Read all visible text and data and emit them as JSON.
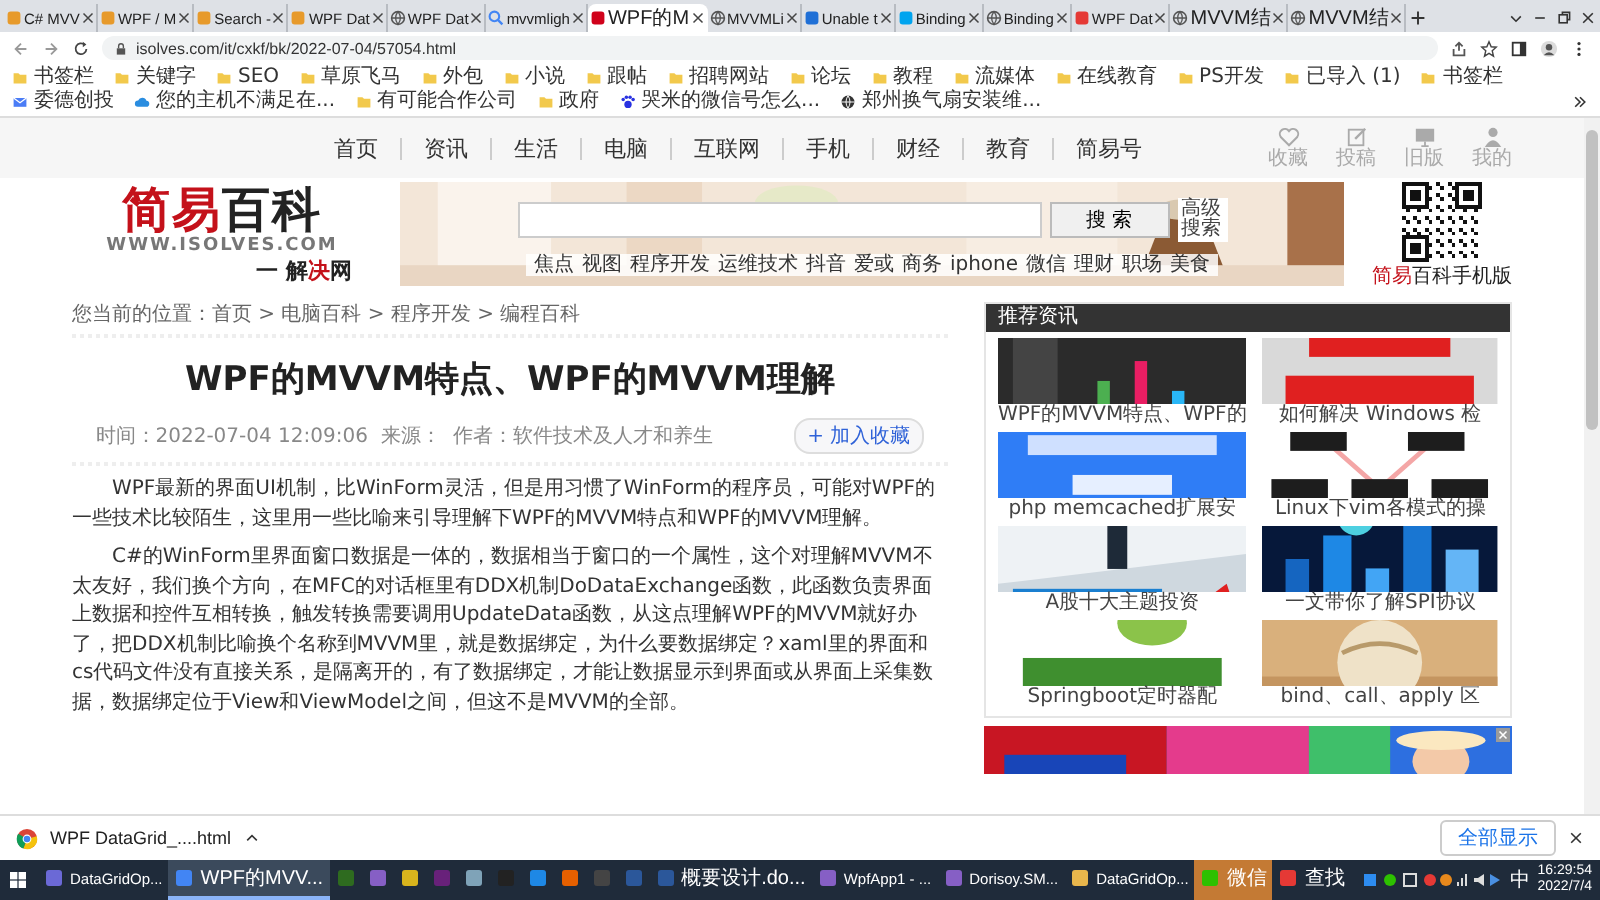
{
  "browser": {
    "tabs": [
      {
        "label": "C# MVV",
        "selected": false,
        "kind": "square",
        "color": "#e79a2b"
      },
      {
        "label": "WPF / M",
        "selected": false,
        "kind": "square",
        "color": "#e79a2b"
      },
      {
        "label": "Search -",
        "selected": false,
        "kind": "square",
        "color": "#e79a2b"
      },
      {
        "label": "WPF Dat",
        "selected": false,
        "kind": "square",
        "color": "#e79a2b"
      },
      {
        "label": "WPF Dat",
        "selected": false,
        "kind": "globe",
        "color": "#555555"
      },
      {
        "label": "mvvmligh",
        "selected": false,
        "kind": "search",
        "color": "#4285f4"
      },
      {
        "label": "WPF的M",
        "selected": true,
        "kind": "square",
        "color": "#d0021b"
      },
      {
        "label": "MVVMLi",
        "selected": false,
        "kind": "globe",
        "color": "#555555"
      },
      {
        "label": "Unable t",
        "selected": false,
        "kind": "square",
        "color": "#1f6fd6"
      },
      {
        "label": "Binding",
        "selected": false,
        "kind": "square",
        "color": "#00a4ef"
      },
      {
        "label": "Binding",
        "selected": false,
        "kind": "globe",
        "color": "#555555"
      },
      {
        "label": "WPF Dat",
        "selected": false,
        "kind": "square",
        "color": "#e53935"
      },
      {
        "label": "MVVM结",
        "selected": false,
        "kind": "globe",
        "color": "#555555"
      },
      {
        "label": "MVVM结",
        "selected": false,
        "kind": "globe",
        "color": "#555555"
      }
    ],
    "address": "isolves.com/it/cxkf/bk/2022-07-04/57054.html",
    "bookmarks": [
      {
        "label": "书签栏",
        "kind": "folder"
      },
      {
        "label": "关键字",
        "kind": "folder"
      },
      {
        "label": "SEO",
        "kind": "folder"
      },
      {
        "label": "草原飞马",
        "kind": "folder"
      },
      {
        "label": "外包",
        "kind": "folder"
      },
      {
        "label": "小说",
        "kind": "folder"
      },
      {
        "label": "跟帖",
        "kind": "folder"
      },
      {
        "label": "招聘网站",
        "kind": "folder"
      },
      {
        "label": "论坛",
        "kind": "folder"
      },
      {
        "label": "教程",
        "kind": "folder"
      },
      {
        "label": "流媒体",
        "kind": "folder"
      },
      {
        "label": "在线教育",
        "kind": "folder"
      },
      {
        "label": "PS开发",
        "kind": "folder"
      },
      {
        "label": "已导入 (1)",
        "kind": "folder"
      },
      {
        "label": "书签栏",
        "kind": "folder"
      },
      {
        "label": "委德创投",
        "kind": "mail"
      },
      {
        "label": "您的主机不满足在...",
        "kind": "cloud"
      },
      {
        "label": "有可能合作公司",
        "kind": "folder"
      },
      {
        "label": "政府",
        "kind": "folder"
      },
      {
        "label": "哭米的微信号怎么...",
        "kind": "paw"
      },
      {
        "label": "郑州换气扇安装维...",
        "kind": "globe"
      }
    ]
  },
  "site": {
    "nav": [
      "首页",
      "资讯",
      "生活",
      "电脑",
      "互联网",
      "手机",
      "财经",
      "教育",
      "简易号"
    ],
    "nav_icons": [
      {
        "kind": "heart",
        "label": "收藏"
      },
      {
        "kind": "edit",
        "label": "投稿"
      },
      {
        "kind": "monitor",
        "label": "旧版"
      },
      {
        "kind": "person",
        "label": "我的"
      }
    ],
    "logo": {
      "title": [
        {
          "text": "简易",
          "accent": true
        },
        {
          "text": "百科",
          "accent": false
        }
      ],
      "url": "WWW.ISOLVES.COM",
      "slogan": [
        {
          "text": "一 解",
          "accent": false
        },
        {
          "text": "决",
          "accent": true
        },
        {
          "text": "网",
          "accent": false
        }
      ]
    },
    "search": {
      "button": "搜 索",
      "advanced": "高级搜索",
      "hot": [
        "焦点",
        "视图",
        "程序开发",
        "运维技术",
        "抖音",
        "爱或",
        "商务",
        "iphone",
        "微信",
        "理财",
        "职场",
        "美食"
      ]
    },
    "qr": {
      "caption": [
        {
          "text": "简易",
          "accent": true
        },
        {
          "text": "百科手机版",
          "accent": false
        }
      ]
    },
    "breadcrumb": "您当前的位置：首页 > 电脑百科 > 程序开发 > 编程百科",
    "article": {
      "title": "WPF的MVVM特点、WPF的MVVM理解",
      "meta": "时间：2022-07-04 12:09:06  来源：  作者：软件技术及人才和养生",
      "favorite": "+ 加入收藏",
      "paragraphs": [
        "WPF最新的界面UI机制，比WinForm灵活，但是用习惯了WinForm的程序员，可能对WPF的一些技术比较陌生，这里用一些比喻来引导理解下WPF的MVVM特点和WPF的MVVM理解。",
        "C#的WinForm里界面窗口数据是一体的，数据相当于窗口的一个属性，这个对理解MVVM不太友好，我们换个方向，在MFC的对话框里有DDX机制DoDataExchange函数，此函数负责界面上数据和控件互相转换，触发转换需要调用UpdateData函数，从这点理解WPF的MVVM就好办了，把DDX机制比喻换个名称到MVVM里，就是数据绑定，为什么要数据绑定？xaml里的界面和cs代码文件没有直接关系，是隔离开的，有了数据绑定，才能让数据显示到界面或从界面上采集数据，数据绑定位于View和ViewModel之间，但这不是MVVM的全部。"
      ]
    },
    "sidebar": {
      "title": "推荐资讯",
      "items": [
        {
          "caption": "WPF的MVVM特点、WPF的"
        },
        {
          "caption": "如何解决 Windows 检"
        },
        {
          "caption": "php memcached扩展安"
        },
        {
          "caption": "Linux下vim各模式的操"
        },
        {
          "caption": "A股十大主题投资"
        },
        {
          "caption": "一文带你了解SPI协议"
        },
        {
          "caption": "Springboot定时器配"
        },
        {
          "caption": "bind、call、apply 区"
        }
      ]
    }
  },
  "download": {
    "file": "WPF DataGrid_....html",
    "show_all": "全部显示"
  },
  "taskbar": {
    "items": [
      {
        "label": "DataGridOp...",
        "color": "#6b69d6",
        "selected": false,
        "alert": false
      },
      {
        "label": "WPF的MVV...",
        "color": "#4285f4",
        "selected": true,
        "alert": false
      },
      {
        "color": "#2e6b1f",
        "selected": false,
        "alert": false
      },
      {
        "color": "#865fc5",
        "selected": false,
        "alert": false
      },
      {
        "color": "#d8b41d",
        "selected": false,
        "alert": false
      },
      {
        "color": "#68217a",
        "selected": false,
        "alert": false
      },
      {
        "color": "#7fa3b8",
        "selected": false,
        "alert": false
      },
      {
        "color": "#222222",
        "selected": false,
        "alert": false
      },
      {
        "color": "#1e88e5",
        "selected": false,
        "alert": false
      },
      {
        "color": "#e66000",
        "selected": false,
        "alert": false
      },
      {
        "color": "#444444",
        "selected": false,
        "alert": false
      },
      {
        "color": "#2b579a",
        "selected": false,
        "alert": false
      },
      {
        "label": "概要设计.do...",
        "color": "#2b579a",
        "selected": false,
        "alert": false
      },
      {
        "label": "WpfApp1 - ...",
        "color": "#865fc5",
        "selected": false,
        "alert": false
      },
      {
        "label": "Dorisoy.SM...",
        "color": "#865fc5",
        "selected": false,
        "alert": false
      },
      {
        "label": "DataGridOp...",
        "color": "#e8b64c",
        "selected": false,
        "alert": false
      },
      {
        "label": "微信",
        "color": "#2dc100",
        "selected": false,
        "alert": true
      },
      {
        "label": "查找",
        "color": "#e53935",
        "selected": false,
        "alert": false
      }
    ],
    "ime": "中",
    "time": "16:29:54",
    "date": "2022/7/4"
  }
}
